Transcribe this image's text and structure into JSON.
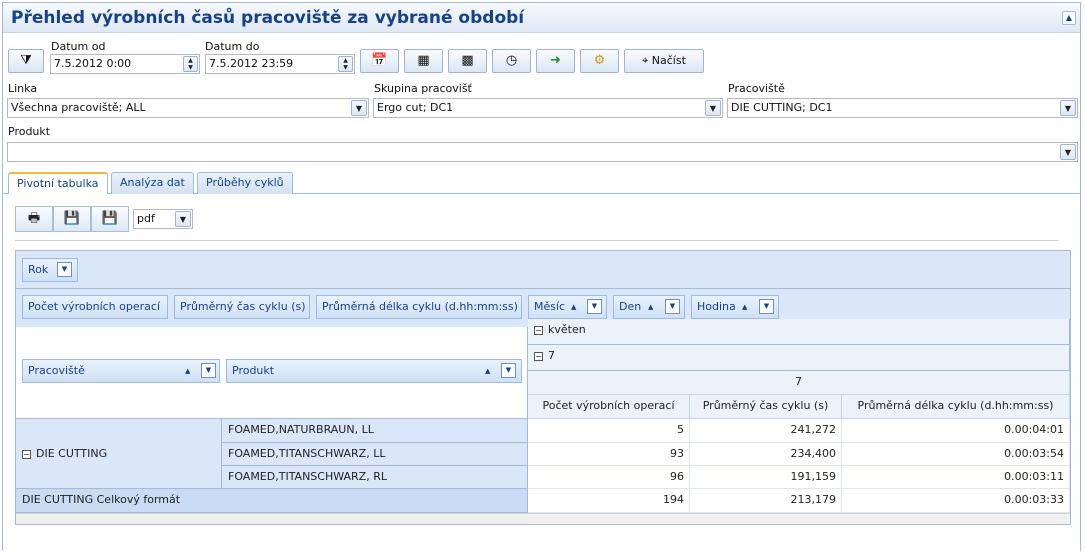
{
  "title": "Přehled výrobních časů pracoviště za vybrané období",
  "filters": {
    "datum_od_label": "Datum od",
    "datum_od_value": "7.5.2012 0:00",
    "datum_do_label": "Datum do",
    "datum_do_value": "7.5.2012 23:59",
    "nacist_label": "Načíst",
    "linka_label": "Linka",
    "linka_value": "Všechna pracoviště; ALL",
    "skupina_label": "Skupina pracovišť",
    "skupina_value": "Ergo cut; DC1",
    "pracoviste_label": "Pracoviště",
    "pracoviste_value": "DIE CUTTING; DC1",
    "produkt_label": "Produkt",
    "produkt_value": ""
  },
  "tabs": [
    {
      "label": "Pivotní tabulka"
    },
    {
      "label": "Analýza dat"
    },
    {
      "label": "Průběhy cyklů"
    }
  ],
  "export": {
    "format": "pdf"
  },
  "pivot": {
    "filter_field": "Rok",
    "data_fields": [
      "Počet výrobních operací",
      "Průměrný čas cyklu (s)",
      "Průměrná délka cyklu (d.hh:mm:ss)"
    ],
    "column_fields": [
      "Měsíc",
      "Den",
      "Hodina"
    ],
    "row_fields": [
      "Pracoviště",
      "Produkt"
    ],
    "month": "květen",
    "day": "7",
    "hour": "7",
    "col_headers": [
      "Počet výrobních operací",
      "Průměrný čas cyklu (s)",
      "Průměrná délka cyklu (d.hh:mm:ss)"
    ],
    "group": "DIE CUTTING",
    "rows": [
      {
        "produkt": "FOAMED,NATURBRAUN, LL",
        "count": "5",
        "avg": "241,272",
        "len": "0.00:04:01"
      },
      {
        "produkt": "FOAMED,TITANSCHWARZ, LL",
        "count": "93",
        "avg": "234,400",
        "len": "0.00:03:54"
      },
      {
        "produkt": "FOAMED,TITANSCHWARZ, RL",
        "count": "96",
        "avg": "191,159",
        "len": "0.00:03:11"
      }
    ],
    "total": {
      "label": "DIE CUTTING Celkový formát",
      "count": "194",
      "avg": "213,179",
      "len": "0.00:03:33"
    }
  }
}
